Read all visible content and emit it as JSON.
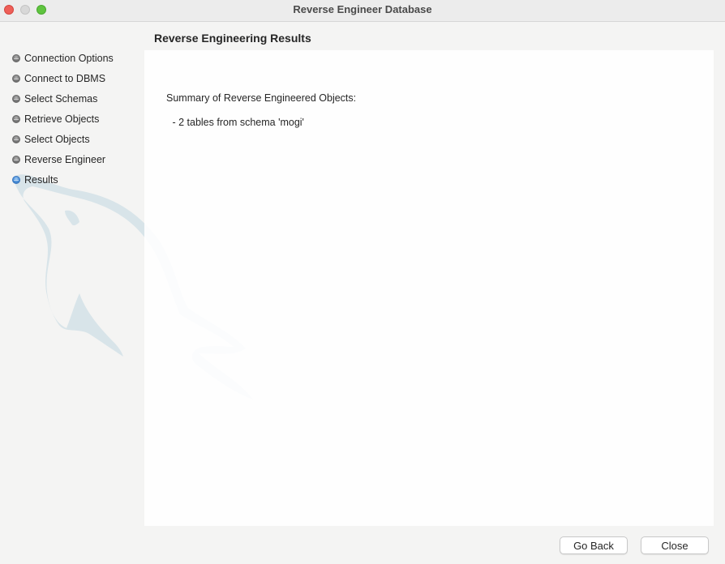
{
  "window": {
    "title": "Reverse Engineer Database"
  },
  "sidebar": {
    "steps": [
      {
        "label": "Connection Options",
        "state": "done"
      },
      {
        "label": "Connect to DBMS",
        "state": "done"
      },
      {
        "label": "Select Schemas",
        "state": "done"
      },
      {
        "label": "Retrieve Objects",
        "state": "done"
      },
      {
        "label": "Select Objects",
        "state": "done"
      },
      {
        "label": "Reverse Engineer",
        "state": "done"
      },
      {
        "label": "Results",
        "state": "active"
      }
    ]
  },
  "main": {
    "title": "Reverse Engineering Results",
    "summary_heading": "Summary of Reverse Engineered Objects:",
    "summary_items": [
      " - 2 tables from schema 'mogi'"
    ]
  },
  "footer": {
    "back_label": "Go Back",
    "close_label": "Close"
  },
  "colors": {
    "active_step": "#4a8fd8",
    "done_step": "#7a7a7a",
    "close_light": "#ee5f58",
    "max_light": "#5fc43f"
  }
}
